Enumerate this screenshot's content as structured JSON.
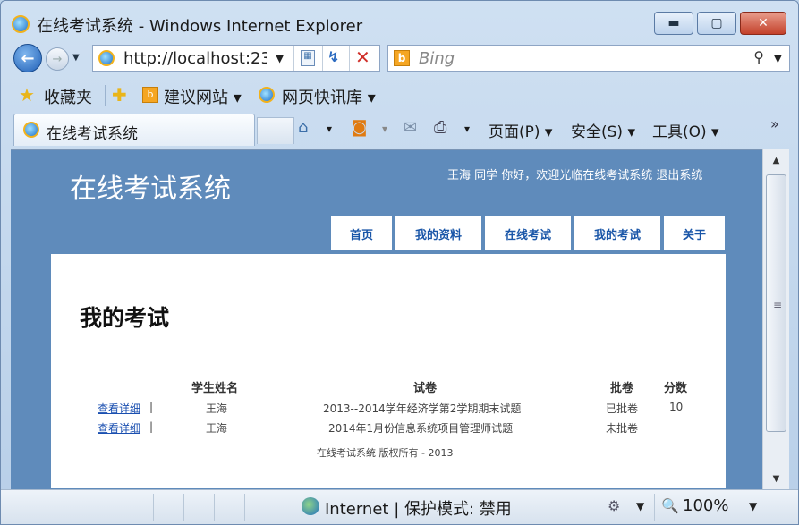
{
  "window": {
    "title": "在线考试系统 - Windows Internet Explorer",
    "min_glyph": "▬",
    "max_glyph": "▢",
    "close_glyph": "✕"
  },
  "address": {
    "url": "http://localhost:23",
    "back_glyph": "←",
    "forward_glyph": "→",
    "dropdown_glyph": "▼",
    "refresh_glyph": "↯",
    "stop_glyph": "✕"
  },
  "search": {
    "placeholder": "Bing",
    "bing_glyph": "b",
    "go_glyph": "⚲",
    "dropdown_glyph": "▼"
  },
  "favorites": {
    "label": "收藏夹",
    "star_glyph": "★",
    "add_glyph": "✚",
    "items": [
      {
        "label": "建议网站 ▾",
        "icon": "bing-icon"
      },
      {
        "label": "网页快讯库 ▾",
        "icon": "ie-icon"
      }
    ]
  },
  "tab": {
    "label": "在线考试系统"
  },
  "commands": {
    "home_glyph": "⌂",
    "feeds_glyph": "◙",
    "mail_glyph": "✉",
    "print_glyph": "⎙",
    "arrow": "▾",
    "page": "页面(P) ▾",
    "safety": "安全(S) ▾",
    "tools": "工具(O) ▾",
    "more": "»"
  },
  "site": {
    "title": "在线考试系统",
    "welcome": "王海 同学 你好，欢迎光临在线考试系统  退出系统",
    "nav": [
      {
        "label": "首页"
      },
      {
        "label": "我的资料"
      },
      {
        "label": "在线考试"
      },
      {
        "label": "我的考试"
      },
      {
        "label": "关于"
      }
    ]
  },
  "exams": {
    "heading": "我的考试",
    "columns": {
      "student": "学生姓名",
      "paper": "试卷",
      "status": "批卷",
      "score": "分数"
    },
    "rows": [
      {
        "action": "查看详细",
        "sep": "|",
        "student": "王海",
        "paper": "2013--2014学年经济学第2学期期末试题",
        "status": "已批卷",
        "score": "10"
      },
      {
        "action": "查看详细",
        "sep": "|",
        "student": "王海",
        "paper": "2014年1月份信息系统项目管理师试题",
        "status": "未批卷",
        "score": ""
      }
    ],
    "footer": "在线考试系统 版权所有 - 2013"
  },
  "scrollbar": {
    "up_glyph": "▲",
    "down_glyph": "▼",
    "grip_glyph": "≡"
  },
  "status": {
    "zone": "Internet | 保护模式: 禁用",
    "zoom": "100%",
    "zoom_glyph": "🔍",
    "dropdown_glyph": "▼"
  }
}
